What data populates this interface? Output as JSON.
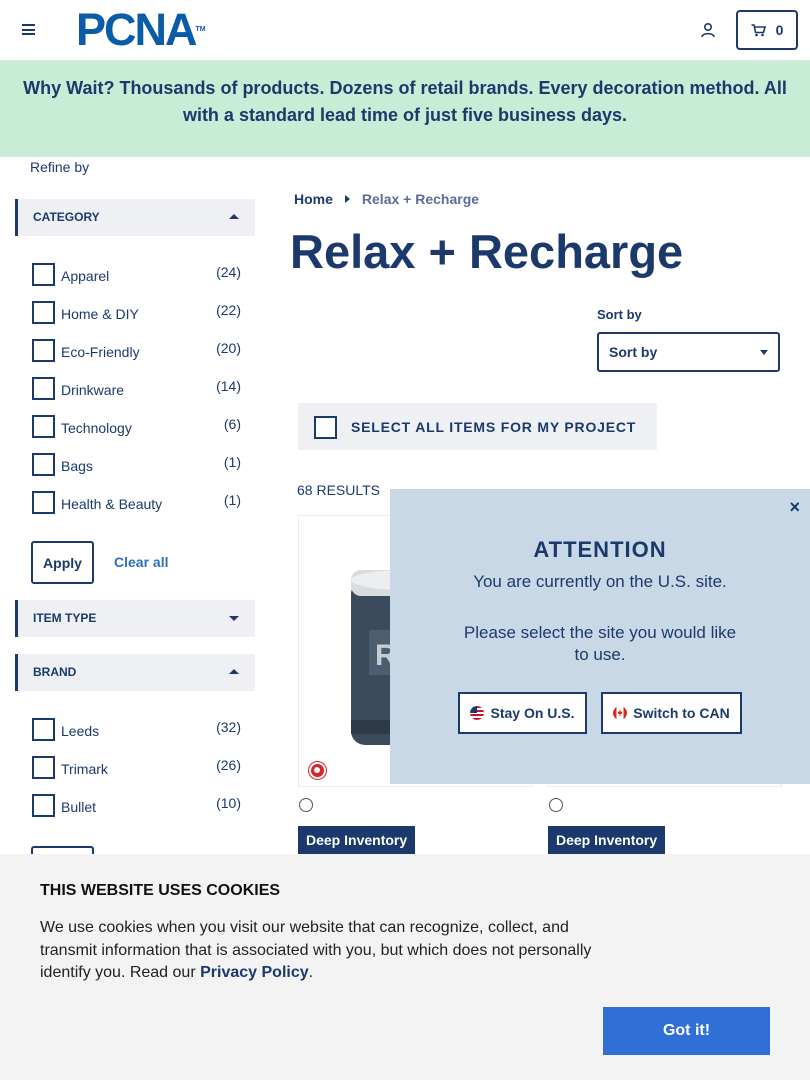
{
  "header": {
    "logo_text": "PCNA",
    "logo_tm": "TM",
    "cart_count": "0",
    "icons": [
      "menu-icon",
      "user-icon",
      "cart-icon"
    ]
  },
  "banner": {
    "text": "Why Wait? Thousands of products. Dozens of retail brands. Every decoration method. All with a standard lead time of just five business days."
  },
  "sidebar": {
    "refine_label": "Refine by",
    "category": {
      "title": "CATEGORY",
      "options": [
        {
          "label": "Apparel",
          "count": "(24)"
        },
        {
          "label": "Home & DIY",
          "count": "(22)"
        },
        {
          "label": "Eco-Friendly",
          "count": "(20)"
        },
        {
          "label": "Drinkware",
          "count": "(14)"
        },
        {
          "label": "Technology",
          "count": "(6)"
        },
        {
          "label": "Bags",
          "count": "(1)"
        },
        {
          "label": "Health & Beauty",
          "count": "(1)"
        }
      ],
      "apply_label": "Apply",
      "clear_label": "Clear all"
    },
    "item_type": {
      "title": "ITEM TYPE"
    },
    "brand": {
      "title": "BRAND",
      "options": [
        {
          "label": "Leeds",
          "count": "(32)"
        },
        {
          "label": "Trimark",
          "count": "(26)"
        },
        {
          "label": "Bullet",
          "count": "(10)"
        }
      ]
    }
  },
  "main": {
    "breadcrumb": {
      "home": "Home",
      "current": "Relax + Recharge"
    },
    "title": "Relax + Recharge",
    "sort": {
      "label": "Sort by",
      "value": "Sort by"
    },
    "select_all_label": "SELECT ALL ITEMS FOR MY PROJECT",
    "results": "68 RESULTS",
    "products": [
      {
        "badge": "Deep Inventory",
        "swatch_color": "#d8232a"
      },
      {
        "badge": "Deep Inventory"
      }
    ]
  },
  "modal": {
    "close": "×",
    "title": "ATTENTION",
    "message1": "You are currently on the U.S. site.",
    "message2": "Please select the site you would like to use.",
    "stay_label": "Stay On U.S.",
    "switch_label": "Switch to CAN"
  },
  "cookie": {
    "title": "THIS WEBSITE USES COOKIES",
    "text": "We use cookies when you visit our website that can recognize, collect, and transmit information that is associated with you, but which does not personally identify you. Read our",
    "link": "Privacy Policy",
    "end": ".",
    "button": "Got it!"
  },
  "colors": {
    "navy": "#1b3a6b",
    "banner_bg": "#c9ecd6",
    "modal_bg": "#c9d8e6",
    "accent_blue": "#2f6fd6",
    "logo_blue": "#0a5ba8"
  }
}
